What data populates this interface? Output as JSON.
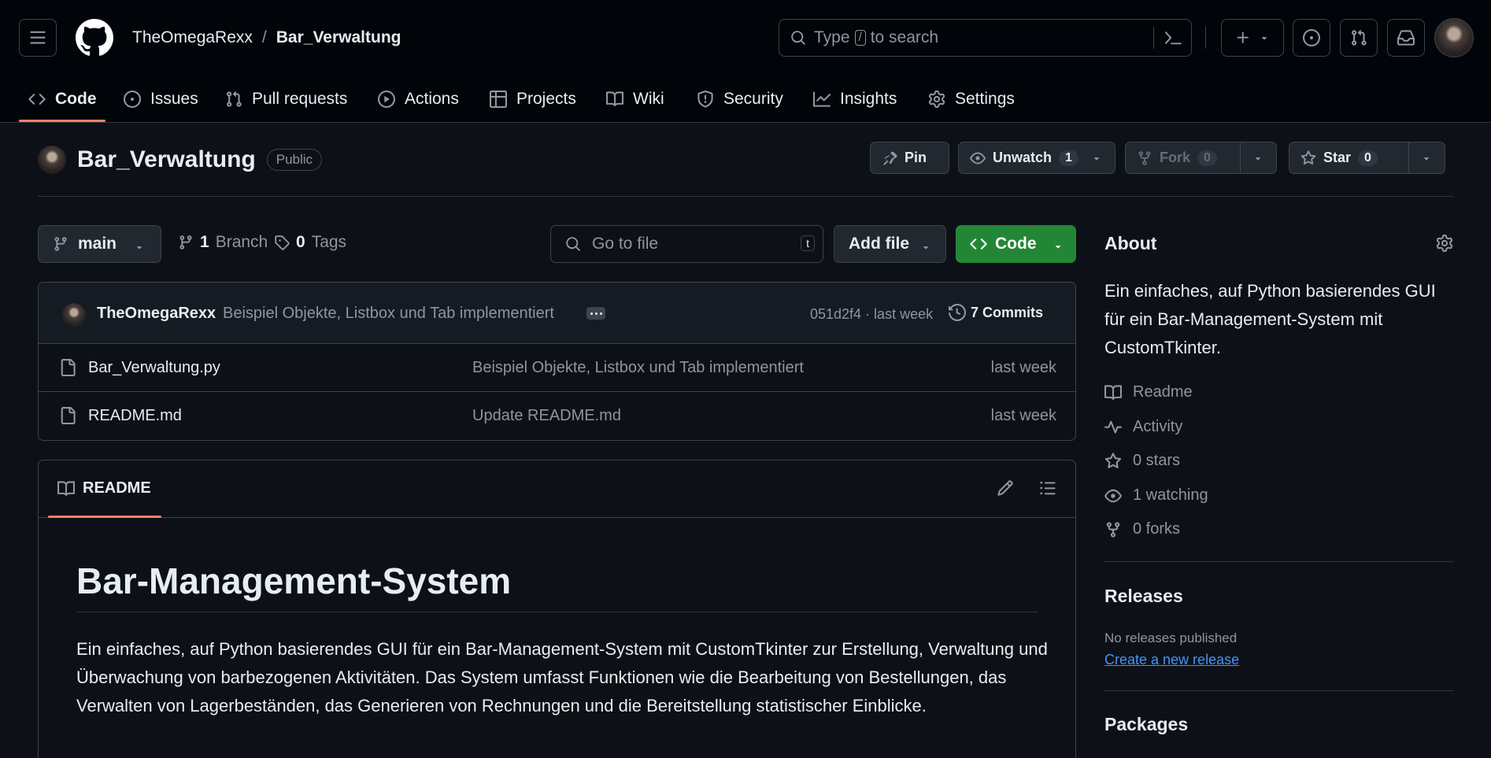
{
  "header": {
    "owner": "TheOmegaRexx",
    "separator": "/",
    "repo": "Bar_Verwaltung",
    "search": {
      "prefix": "Type",
      "key": "/",
      "suffix": "to search"
    }
  },
  "tabs": [
    {
      "label": "Code"
    },
    {
      "label": "Issues"
    },
    {
      "label": "Pull requests"
    },
    {
      "label": "Actions"
    },
    {
      "label": "Projects"
    },
    {
      "label": "Wiki"
    },
    {
      "label": "Security"
    },
    {
      "label": "Insights"
    },
    {
      "label": "Settings"
    }
  ],
  "repo": {
    "name": "Bar_Verwaltung",
    "visibility": "Public",
    "pin_label": "Pin",
    "watch_label": "Unwatch",
    "watch_count": "1",
    "fork_label": "Fork",
    "fork_count": "0",
    "star_label": "Star",
    "star_count": "0"
  },
  "filenav": {
    "branch": "main",
    "branch_count": "1",
    "branch_label": "Branch",
    "tag_count": "0",
    "tag_label": "Tags",
    "goto_placeholder": "Go to file",
    "goto_key": "t",
    "add_file": "Add file",
    "code": "Code"
  },
  "commit": {
    "author": "TheOmegaRexx",
    "message": "Beispiel Objekte, Listbox und Tab implementiert",
    "hash_time": "051d2f4 · last week",
    "commits": "7 Commits"
  },
  "files": [
    {
      "name": "Bar_Verwaltung.py",
      "message": "Beispiel Objekte, Listbox und Tab implementiert",
      "date": "last week"
    },
    {
      "name": "README.md",
      "message": "Update README.md",
      "date": "last week"
    }
  ],
  "readme": {
    "tab": "README",
    "title": "Bar-Management-System",
    "body": "Ein einfaches, auf Python basierendes GUI für ein Bar-Management-System mit CustomTkinter zur Erstellung, Verwaltung und Überwachung von barbezogenen Aktivitäten. Das System umfasst Funktionen wie die Bearbeitung von Bestellungen, das Verwalten von Lagerbeständen, das Generieren von Rechnungen und die Bereitstellung statistischer Einblicke."
  },
  "sidebar": {
    "about_title": "About",
    "about_desc": "Ein einfaches, auf Python basierendes GUI für ein Bar-Management-System mit CustomTkinter.",
    "items": [
      {
        "label": "Readme",
        "icon": "book-icon"
      },
      {
        "label": "Activity",
        "icon": "pulse-icon"
      },
      {
        "label": "0 stars",
        "icon": "star-icon"
      },
      {
        "label": "1 watching",
        "icon": "eye-icon"
      },
      {
        "label": "0 forks",
        "icon": "fork-icon"
      }
    ],
    "releases_title": "Releases",
    "releases_none": "No releases published",
    "releases_link": "Create a new release",
    "packages_title": "Packages"
  },
  "colors": {
    "accent_underline": "#f78166",
    "code_button": "#238636",
    "link": "#4493f8"
  }
}
